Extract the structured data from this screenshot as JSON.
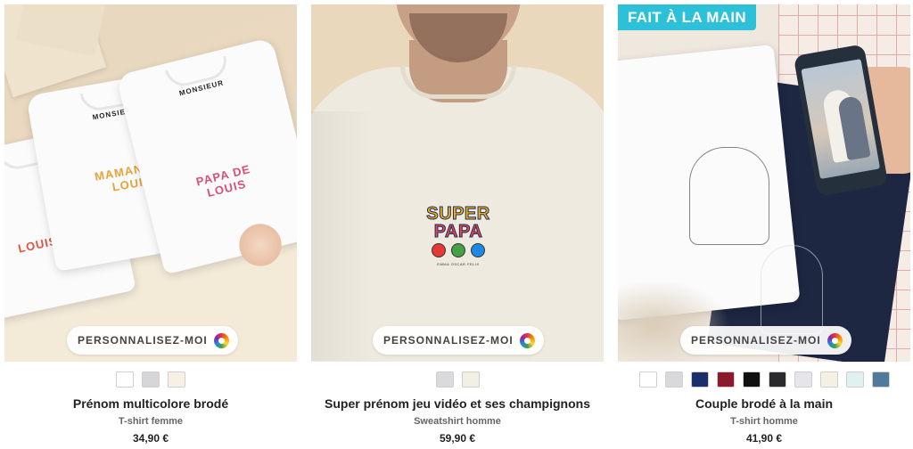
{
  "products": [
    {
      "title": "Prénom multicolore brodé",
      "type": "T-shirt femme",
      "price": "34,90 €",
      "personalize_label": "PERSONNALISEZ-MOI",
      "badge": "",
      "swatches": [
        "#ffffff",
        "#d6d6d8",
        "#f6f1e4"
      ],
      "image": {
        "shirt_brand": "MONSIEUR",
        "embroidery_1": "LOUIS",
        "embroidery_2": "MAMAN DE LOUIS",
        "embroidery_3": "PAPA DE LOUIS"
      }
    },
    {
      "title": "Super prénom jeu vidéo et ses champignons",
      "type": "Sweatshirt homme",
      "price": "59,90 €",
      "personalize_label": "PERSONNALISEZ-MOI",
      "badge": "",
      "swatches": [
        "#dadadc",
        "#f3efe2"
      ],
      "image": {
        "word_1": "SUPER",
        "word_2": "PAPA",
        "names": [
          "EMMA",
          "OSCAR",
          "FELIX"
        ]
      }
    },
    {
      "title": "Couple brodé à la main",
      "type": "T-shirt homme",
      "price": "41,90 €",
      "personalize_label": "PERSONNALISEZ-MOI",
      "badge": "FAIT À LA MAIN",
      "swatches": [
        "#ffffff",
        "#d9d9db",
        "#1a2f6b",
        "#8c1a2b",
        "#111111",
        "#2b2b2d",
        "#e6e6ea",
        "#f5f1e2",
        "#dff2ef",
        "#4f7a9c"
      ]
    }
  ]
}
